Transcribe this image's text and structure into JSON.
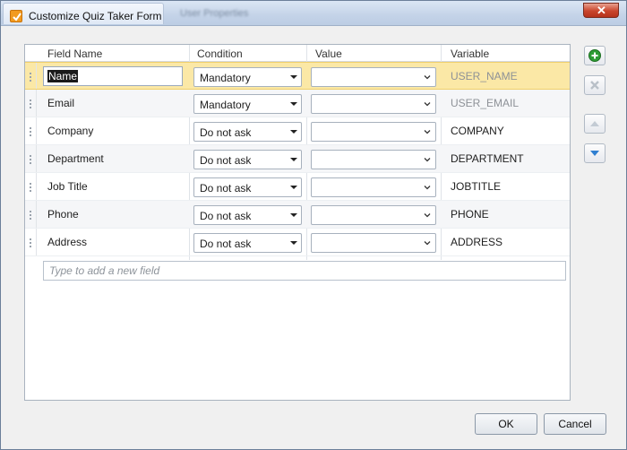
{
  "window": {
    "title": "Customize Quiz Taker Form",
    "background_tab": "User Properties"
  },
  "grid": {
    "columns": [
      "Field Name",
      "Condition",
      "Value",
      "Variable"
    ],
    "rows": [
      {
        "field": "Name",
        "condition": "Mandatory",
        "value": "",
        "variable": "USER_NAME",
        "selected": true
      },
      {
        "field": "Email",
        "condition": "Mandatory",
        "value": "",
        "variable": "USER_EMAIL"
      },
      {
        "field": "Company",
        "condition": "Do not ask",
        "value": "",
        "variable": "COMPANY"
      },
      {
        "field": "Department",
        "condition": "Do not ask",
        "value": "",
        "variable": "DEPARTMENT"
      },
      {
        "field": "Job Title",
        "condition": "Do not ask",
        "value": "",
        "variable": "JOBTITLE"
      },
      {
        "field": "Phone",
        "condition": "Do not ask",
        "value": "",
        "variable": "PHONE"
      },
      {
        "field": "Address",
        "condition": "Do not ask",
        "value": "",
        "variable": "ADDRESS"
      }
    ],
    "new_field_placeholder": "Type to add a new field"
  },
  "side_buttons": [
    "add-icon",
    "delete-icon",
    "move-up-icon",
    "move-down-icon"
  ],
  "buttons": {
    "ok": "OK",
    "cancel": "Cancel"
  },
  "colors": {
    "selection": "#fbe8a6",
    "accent_add": "#2d9c34",
    "accent_move": "#2f7fd1"
  }
}
